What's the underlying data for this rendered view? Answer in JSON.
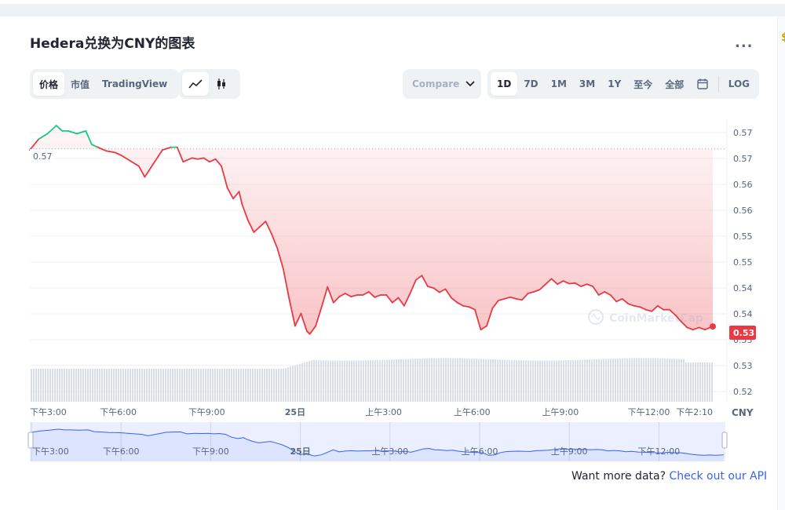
{
  "title": "Hedera兑换为CNY的图表",
  "more_label": "...",
  "type_buttons": [
    "价格",
    "市值",
    "TradingView"
  ],
  "type_active": 0,
  "style_icons": [
    "line-chart-icon",
    "candlestick-icon"
  ],
  "compare_label": "Compare",
  "range_buttons": [
    "1D",
    "7D",
    "1M",
    "3M",
    "1Y",
    "至今",
    "全部"
  ],
  "range_active": 0,
  "log_label": "LOG",
  "watermark": "CoinMarketCap",
  "api": {
    "text": "Want more data?",
    "link": "Check out our API"
  },
  "colors": {
    "down": "#ea3943",
    "up": "#16c784",
    "nav": "#3861fb"
  },
  "chart_data": {
    "type": "line",
    "currency": "CNY",
    "y_ticks": [
      "0.57",
      "0.57",
      "0.56",
      "0.56",
      "0.55",
      "0.55",
      "0.54",
      "0.54",
      "0.53",
      "0.53",
      "0.52"
    ],
    "ylim": [
      0.5195,
      0.5705
    ],
    "x_ticks": [
      "下午3:00",
      "下午6:00",
      "下午9:00",
      "25日",
      "上午3:00",
      "上午6:00",
      "上午9:00",
      "下午12:00",
      "下午2:10"
    ],
    "x_tick_hours": [
      0,
      3,
      6,
      9,
      12,
      15,
      18,
      21,
      23.17
    ],
    "xlim": [
      0,
      23.17
    ],
    "open_price_label": "0.57",
    "open_price": 0.5662,
    "last_price_label": "0.53",
    "navigator_ticks": [
      "下午3:00",
      "下午6:00",
      "下午9:00",
      "25日",
      "上午3:00",
      "上午6:00",
      "上午9:00",
      "下午12:00"
    ],
    "series": [
      {
        "hours": [
          0.0,
          0.3,
          0.6,
          0.9,
          1.1,
          1.3,
          1.6,
          1.9,
          2.1,
          2.3,
          2.6,
          2.9,
          3.1,
          3.4,
          3.7,
          3.9,
          4.2,
          4.5,
          4.8,
          5.0,
          5.2,
          5.5,
          5.7,
          5.9,
          6.1,
          6.3,
          6.5,
          6.7,
          6.9,
          7.1,
          7.2,
          7.4,
          7.6,
          7.8,
          8.0,
          8.2,
          8.4,
          8.6,
          8.8,
          9.0,
          9.2,
          9.4,
          9.5,
          9.7,
          9.9,
          10.1,
          10.3,
          10.5,
          10.7,
          10.9,
          11.1,
          11.3,
          11.5,
          11.7,
          11.9,
          12.1,
          12.3,
          12.5,
          12.7,
          12.9,
          13.1,
          13.3,
          13.5,
          13.7,
          13.9,
          14.1,
          14.3,
          14.5,
          14.7,
          14.9,
          15.1,
          15.3,
          15.5,
          15.7,
          15.9,
          16.1,
          16.3,
          16.5,
          16.7,
          16.9,
          17.1,
          17.3,
          17.5,
          17.7,
          17.9,
          18.1,
          18.3,
          18.5,
          18.7,
          18.9,
          19.1,
          19.3,
          19.5,
          19.7,
          19.9,
          20.1,
          20.3,
          20.5,
          20.7,
          20.9,
          21.1,
          21.3,
          21.5,
          21.7,
          21.9,
          22.1,
          22.3,
          22.5,
          22.7,
          22.9,
          23.17
        ],
        "values": [
          0.566,
          0.568,
          0.569,
          0.5705,
          0.5695,
          0.5695,
          0.569,
          0.5695,
          0.567,
          0.5665,
          0.5658,
          0.5655,
          0.565,
          0.564,
          0.563,
          0.561,
          0.5635,
          0.566,
          0.5665,
          0.5665,
          0.5638,
          0.5645,
          0.5643,
          0.5645,
          0.5638,
          0.5643,
          0.563,
          0.559,
          0.557,
          0.5583,
          0.556,
          0.553,
          0.5508,
          0.5518,
          0.5528,
          0.5505,
          0.5478,
          0.544,
          0.5385,
          0.5335,
          0.5358,
          0.5325,
          0.532,
          0.5335,
          0.537,
          0.5407,
          0.5378,
          0.5389,
          0.5395,
          0.5389,
          0.5392,
          0.5392,
          0.5398,
          0.5388,
          0.5392,
          0.5392,
          0.5378,
          0.5387,
          0.5372,
          0.5395,
          0.542,
          0.5428,
          0.5408,
          0.5405,
          0.5397,
          0.5403,
          0.5387,
          0.5378,
          0.5372,
          0.537,
          0.5365,
          0.5328,
          0.5335,
          0.5368,
          0.5382,
          0.5385,
          0.5388,
          0.5385,
          0.5383,
          0.5395,
          0.5398,
          0.5402,
          0.5412,
          0.5422,
          0.5412,
          0.5418,
          0.5413,
          0.5414,
          0.5408,
          0.5412,
          0.5408,
          0.5392,
          0.5398,
          0.5392,
          0.538,
          0.5385,
          0.5376,
          0.5372,
          0.537,
          0.5365,
          0.5362,
          0.5372,
          0.5365,
          0.5365,
          0.5355,
          0.5343,
          0.5332,
          0.5328,
          0.5332,
          0.5328,
          0.5334
        ]
      }
    ]
  }
}
